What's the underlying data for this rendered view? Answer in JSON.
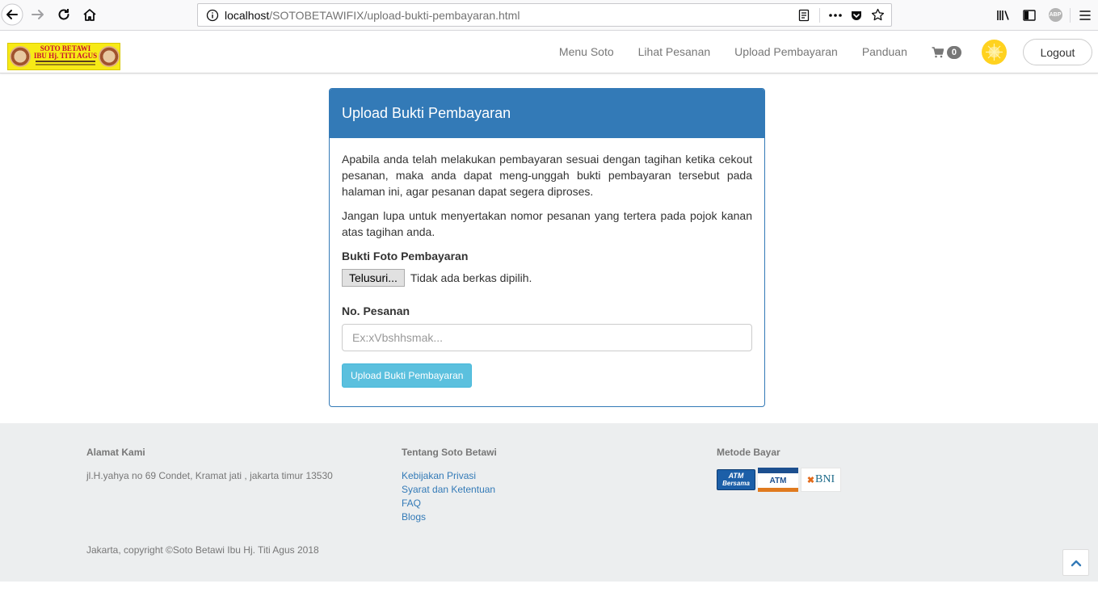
{
  "browser": {
    "url_host": "localhost",
    "url_path": "/SOTOBETAWIFIX/upload-bukti-pembayaran.html",
    "abp_label": "ABP"
  },
  "site": {
    "logo": {
      "line1": "SOTO BETAWI",
      "line2": "IBU Hj. TITI AGUS"
    },
    "nav": [
      {
        "label": "Menu Soto"
      },
      {
        "label": "Lihat Pesanan"
      },
      {
        "label": "Upload Pembayaran"
      },
      {
        "label": "Panduan"
      }
    ],
    "cart_count": "0",
    "logout_label": "Logout"
  },
  "panel": {
    "title": "Upload Bukti Pembayaran",
    "paragraph1": "Apabila anda telah melakukan pembayaran sesuai dengan tagihan ketika cekout pesanan, maka anda dapat meng-unggah bukti pembayaran tersebut pada halaman ini, agar pesanan dapat segera diproses.",
    "paragraph2": "Jangan lupa untuk menyertakan nomor pesanan yang tertera pada pojok kanan atas tagihan anda.",
    "photo_label": "Bukti Foto Pembayaran",
    "browse_label": "Telusuri...",
    "file_status": "Tidak ada berkas dipilih.",
    "order_label": "No. Pesanan",
    "order_placeholder": "Ex:xVbshhsmak...",
    "submit_label": "Upload Bukti Pembayaran"
  },
  "footer": {
    "address_heading": "Alamat Kami",
    "address": "jl.H.yahya no 69 Condet, Kramat jati , jakarta timur 13530",
    "about_heading": "Tentang Soto Betawi",
    "links": [
      {
        "label": "Kebijakan Privasi"
      },
      {
        "label": "Syarat dan Ketentuan"
      },
      {
        "label": "FAQ"
      },
      {
        "label": "Blogs"
      }
    ],
    "payment_heading": "Metode Bayar",
    "payment_logos": {
      "atm_bersama_1": "ATM",
      "atm_bersama_2": "Bersama",
      "atm_bri": "ATM",
      "bni": "BNI"
    },
    "copyright": "Jakarta, copyright ©Soto Betawi Ibu Hj. Titi Agus 2018"
  },
  "colors": {
    "primary": "#337ab7",
    "info": "#5bc0de",
    "footer_bg": "#eceeef"
  }
}
